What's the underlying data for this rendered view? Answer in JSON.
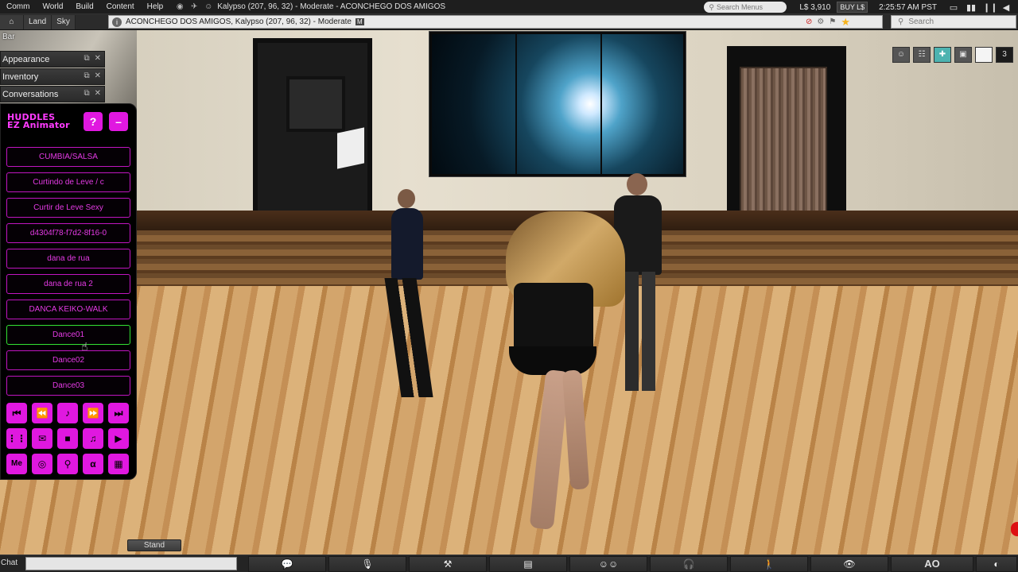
{
  "menubar": {
    "items": [
      "Comm",
      "World",
      "Build",
      "Content",
      "Help"
    ],
    "region_title": "Kalypso (207, 96, 32) - Moderate - ACONCHEGO DOS AMIGOS",
    "search_placeholder": "Search Menus",
    "balance": "L$ 3,910",
    "buy_label": "BUY L$",
    "time": "2:25:57 AM PST"
  },
  "navbar": {
    "home_icon": "home-icon",
    "land": "Land",
    "sky": "Sky",
    "location": "ACONCHEGO DOS AMIGOS, Kalypso (207, 96, 32) - Moderate",
    "maturity_badge": "M",
    "search_placeholder": "Search"
  },
  "bar_label": "Bar",
  "floaters": [
    {
      "title": "Appearance"
    },
    {
      "title": "Inventory"
    },
    {
      "title": "Conversations"
    }
  ],
  "hud": {
    "title_line1": "HUDDLES",
    "title_line2": "EZ Animator",
    "help_label": "?",
    "minimize_label": "–",
    "animations": [
      "CUMBIA/SALSA",
      "Curtindo de Leve / c",
      "Curtir de Leve Sexy",
      "d4304f78-f7d2-8f16-0",
      "dana de rua",
      "dana de rua 2",
      "DANCA KEIKO-WALK",
      "Dance01",
      "Dance02",
      "Dance03"
    ],
    "selected_index": 7,
    "controls_row1": [
      "⏮",
      "⏪",
      "♪",
      "⏩",
      "⏭"
    ],
    "controls_row2": [
      "⋮⋮",
      "✉",
      "■",
      "♫",
      "▶"
    ],
    "controls_row3": [
      "Me",
      "◎",
      "⚲",
      "α",
      "▦"
    ]
  },
  "stand_label": "Stand",
  "bottombar": {
    "chat_label": "Chat",
    "chat_value": "",
    "ao_label": "AO"
  },
  "top_right_count": "3",
  "colors": {
    "hud_magenta": "#e018e0",
    "hud_text": "#e43ae4",
    "hud_selected_border": "#33e233",
    "buy_button": "#3c3c3c",
    "favorite_star": "#f6b21b"
  }
}
